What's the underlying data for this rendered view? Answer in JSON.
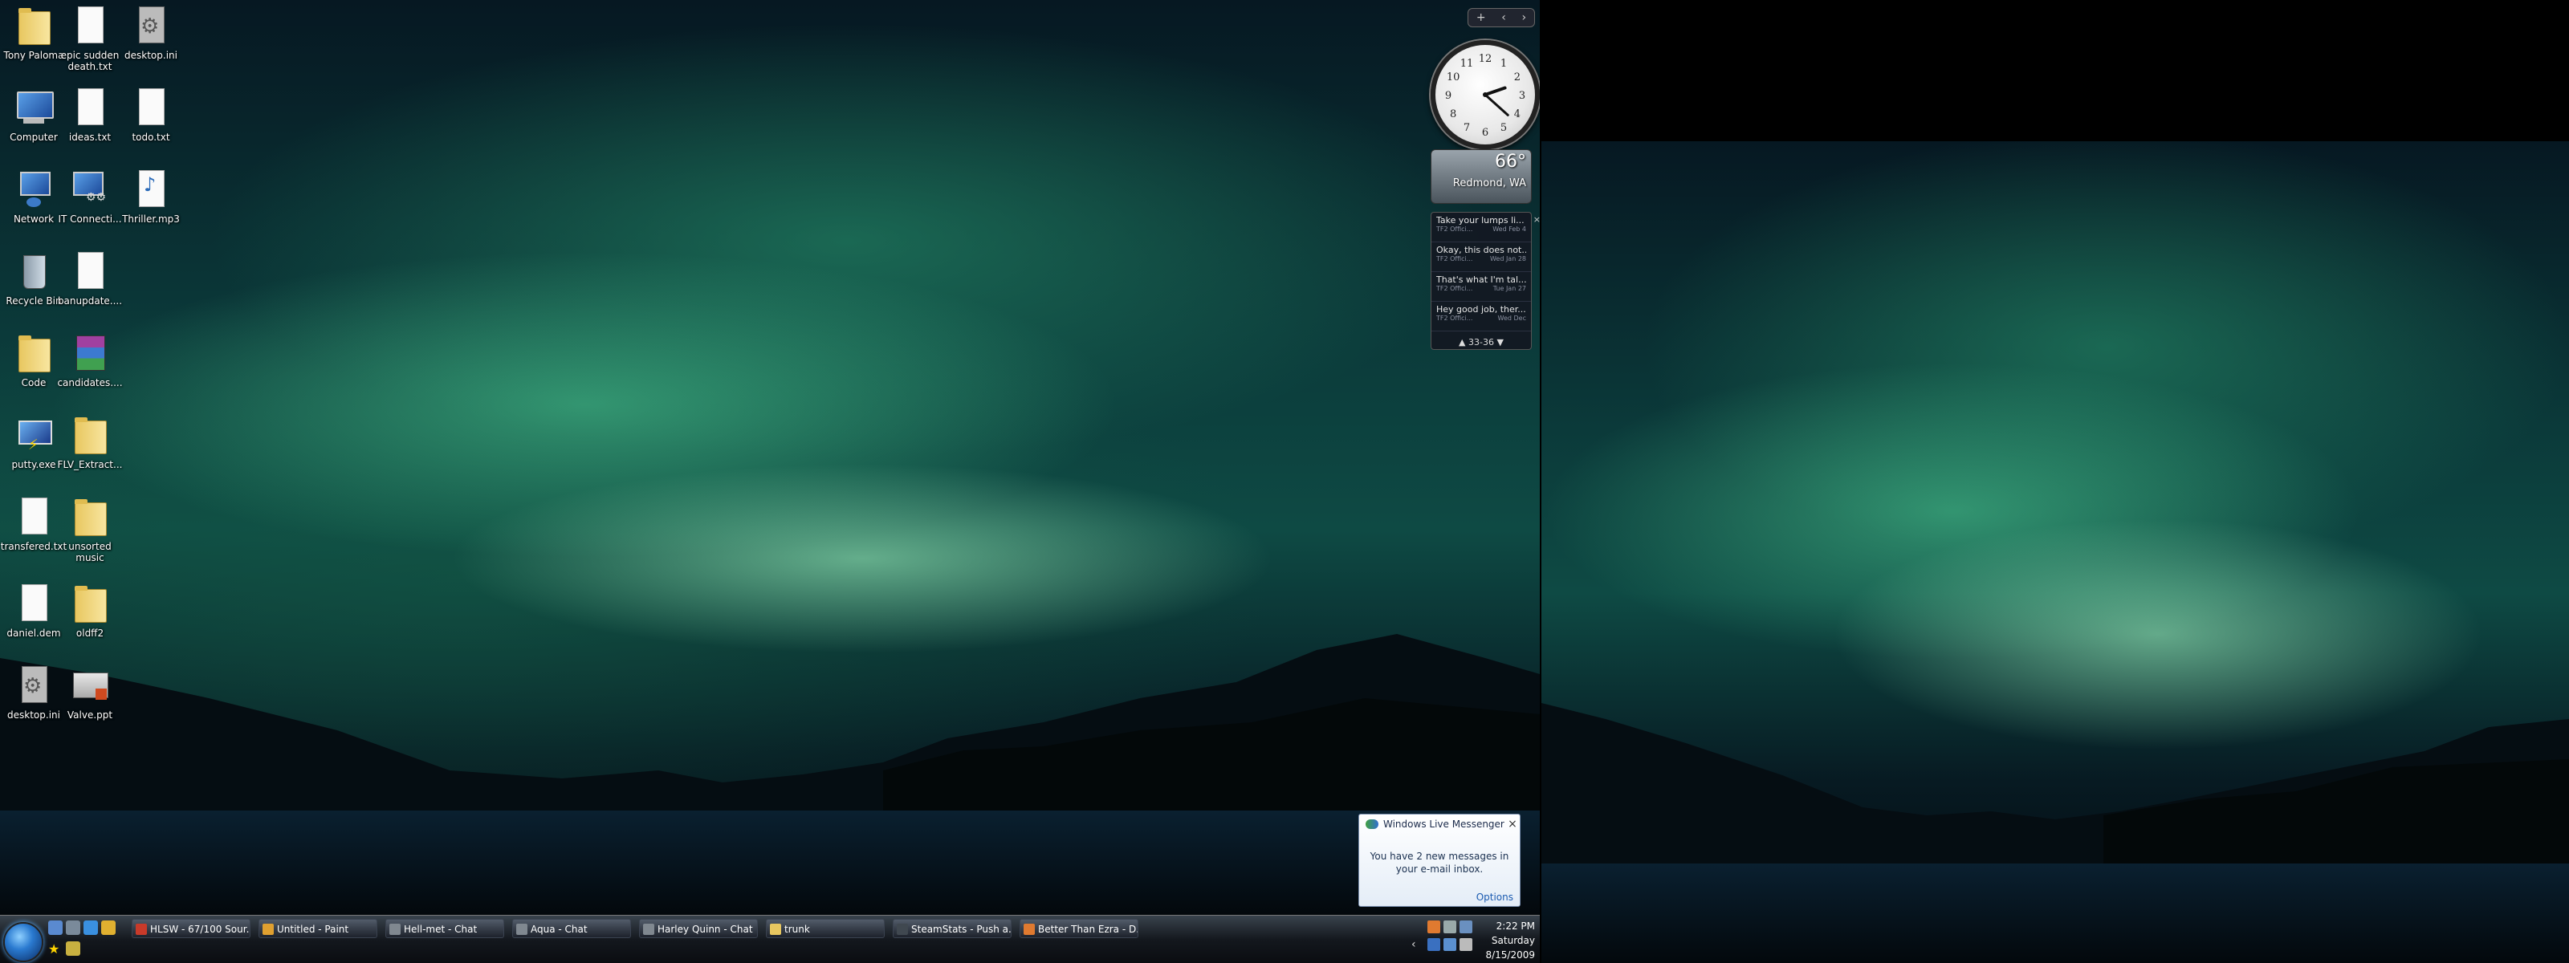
{
  "desktop_icons": [
    {
      "label": "Tony Paloma",
      "icon": "folder-icon"
    },
    {
      "label": "epic sudden death.txt",
      "icon": "text-file-icon"
    },
    {
      "label": "desktop.ini",
      "icon": "settings-file-icon"
    },
    {
      "label": "Computer",
      "icon": "computer-icon"
    },
    {
      "label": "ideas.txt",
      "icon": "text-file-icon"
    },
    {
      "label": "todo.txt",
      "icon": "text-file-icon"
    },
    {
      "label": "Network",
      "icon": "network-icon"
    },
    {
      "label": "IT Connecti...",
      "icon": "network-app-icon"
    },
    {
      "label": "Thriller.mp3",
      "icon": "audio-file-icon"
    },
    {
      "label": "Recycle Bin",
      "icon": "recycle-bin-icon"
    },
    {
      "label": "banupdate....",
      "icon": "text-file-icon"
    },
    {
      "label": "Code",
      "icon": "folder-icon"
    },
    {
      "label": "candidates....",
      "icon": "archive-icon"
    },
    {
      "label": "putty.exe",
      "icon": "app-icon"
    },
    {
      "label": "FLV_Extract...",
      "icon": "folder-icon"
    },
    {
      "label": "transfered.txt",
      "icon": "text-file-icon"
    },
    {
      "label": "unsorted music",
      "icon": "folder-icon"
    },
    {
      "label": "daniel.dem",
      "icon": "text-file-icon"
    },
    {
      "label": "oldff2",
      "icon": "folder-icon"
    },
    {
      "label": "desktop.ini",
      "icon": "settings-file-icon"
    },
    {
      "label": "Valve.ppt",
      "icon": "presentation-icon"
    }
  ],
  "gadget_toolbar": {
    "add": "+",
    "prev": "‹",
    "next": "›"
  },
  "clock_gadget": {
    "hour": 2,
    "minute": 22,
    "numerals": [
      "12",
      "1",
      "2",
      "3",
      "4",
      "5",
      "6",
      "7",
      "8",
      "9",
      "10",
      "11"
    ]
  },
  "weather_gadget": {
    "temperature": "66°",
    "location": "Redmond, WA"
  },
  "feed_gadget": {
    "items": [
      {
        "title": "Take your lumps li...",
        "source": "TF2 Offici...",
        "date": "Wed Feb 4"
      },
      {
        "title": "Okay, this does not...",
        "source": "TF2 Offici...",
        "date": "Wed Jan 28"
      },
      {
        "title": "That's what I'm tal...",
        "source": "TF2 Offici...",
        "date": "Tue Jan 27"
      },
      {
        "title": "Hey good job, ther...",
        "source": "TF2 Offici...",
        "date": "Wed Dec"
      }
    ],
    "range": "33-36",
    "close": "×"
  },
  "notification": {
    "title": "Windows Live Messenger",
    "close": "×",
    "message": "You have 2 new messages in your e-mail inbox.",
    "options": "Options"
  },
  "taskbar": {
    "buttons": [
      {
        "label": "HLSW - 67/100 Sour...",
        "color": "#c83a2a"
      },
      {
        "label": "Untitled - Paint",
        "color": "#e0a030"
      },
      {
        "label": "Hell-met - Chat",
        "color": "#808890"
      },
      {
        "label": "Aqua - Chat",
        "color": "#808890"
      },
      {
        "label": "Harley Quinn - Chat",
        "color": "#808890"
      },
      {
        "label": "trunk",
        "color": "#e8c760"
      },
      {
        "label": "SteamStats - Push a...",
        "color": "#404850"
      },
      {
        "label": "Better Than Ezra - D...",
        "color": "#e07a30"
      }
    ],
    "time": "2:22 PM",
    "day": "Saturday",
    "date": "8/15/2009"
  },
  "colors": {
    "accent": "#2a7ad0",
    "aurora": "#7af0b0"
  }
}
